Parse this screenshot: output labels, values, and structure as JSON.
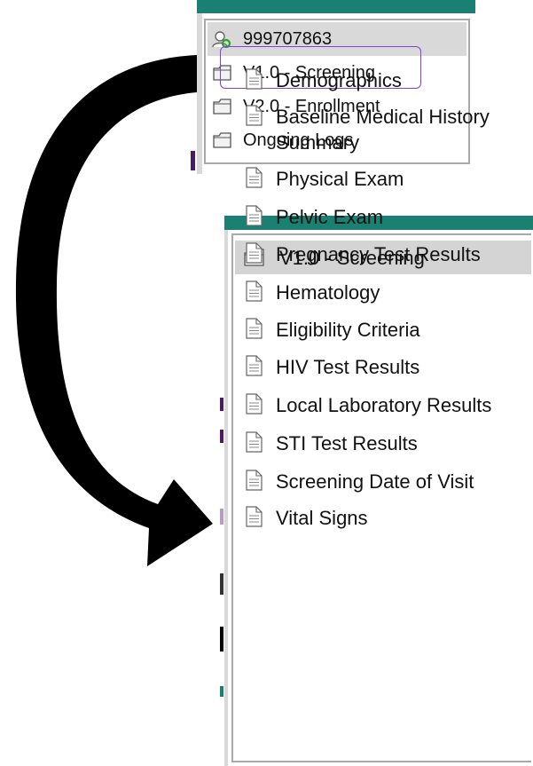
{
  "top_tree": {
    "items": [
      {
        "label": "999707863",
        "icon": "participant-icon",
        "selected": true
      },
      {
        "label": "V1.0 - Screening",
        "icon": "folder-icon"
      },
      {
        "label": "V2.0 - Enrollment",
        "icon": "folder-icon"
      },
      {
        "label": "Ongoing Logs",
        "icon": "folder-icon"
      }
    ]
  },
  "bottom_tree": {
    "folder": {
      "label": "V1.0 - Screening",
      "icon": "folder-icon"
    },
    "forms": [
      {
        "label": "Demographics",
        "icon": "document-icon"
      },
      {
        "label": "Baseline Medical History",
        "label2": "Summary",
        "icon": "document-icon"
      },
      {
        "label": "Physical Exam",
        "icon": "document-icon"
      },
      {
        "label": "Pelvic Exam",
        "icon": "document-icon"
      },
      {
        "label": "Pregnancy Test Results",
        "icon": "document-icon"
      },
      {
        "label": "Hematology",
        "icon": "document-icon"
      },
      {
        "label": "Eligibility Criteria",
        "icon": "document-icon"
      },
      {
        "label": "HIV Test Results",
        "icon": "document-icon"
      },
      {
        "label": "Local Laboratory Results",
        "icon": "document-icon"
      },
      {
        "label": "STI Test Results",
        "icon": "document-icon"
      },
      {
        "label": "Screening Date of Visit",
        "icon": "document-icon"
      },
      {
        "label": "Vital Signs",
        "icon": "document-icon"
      }
    ]
  },
  "colors": {
    "teal_bar": "#1a8071",
    "highlight": "#7a45d6",
    "selected_row": "#d9d9d9",
    "arrow": "#000000"
  }
}
